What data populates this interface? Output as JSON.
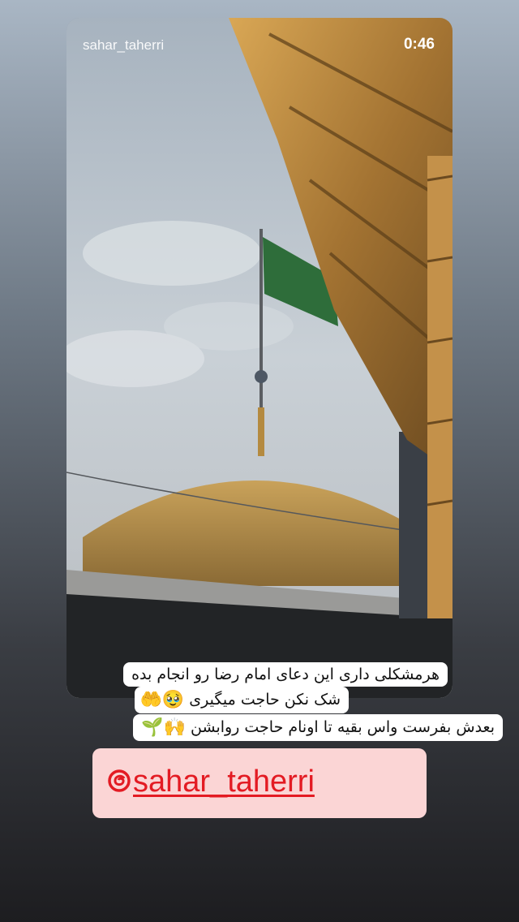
{
  "story": {
    "username": "sahar_taherri",
    "elapsed_time": "0:46"
  },
  "caption": {
    "line1": "هرمشکلی داری این دعای امام رضا رو انجام بده",
    "line2_text": "شک نکن حاجت میگیری",
    "line2_emojis": "🥹🤲",
    "line3_text": "بعدش بفرست واس بقیه تا اونام حاجت روابشن",
    "line3_emojis": "🙌🌱"
  },
  "mention": {
    "handle": "sahar_taherri",
    "icon": "threads-icon",
    "color": "#e31b23",
    "background": "#fbd5d5"
  }
}
